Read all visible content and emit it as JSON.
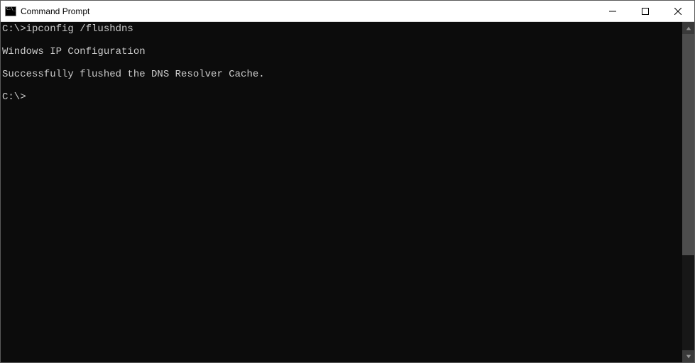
{
  "window": {
    "title": "Command Prompt"
  },
  "terminal": {
    "lines": [
      "C:\\>ipconfig /flushdns",
      "",
      "Windows IP Configuration",
      "",
      "Successfully flushed the DNS Resolver Cache.",
      "",
      "C:\\>"
    ]
  }
}
